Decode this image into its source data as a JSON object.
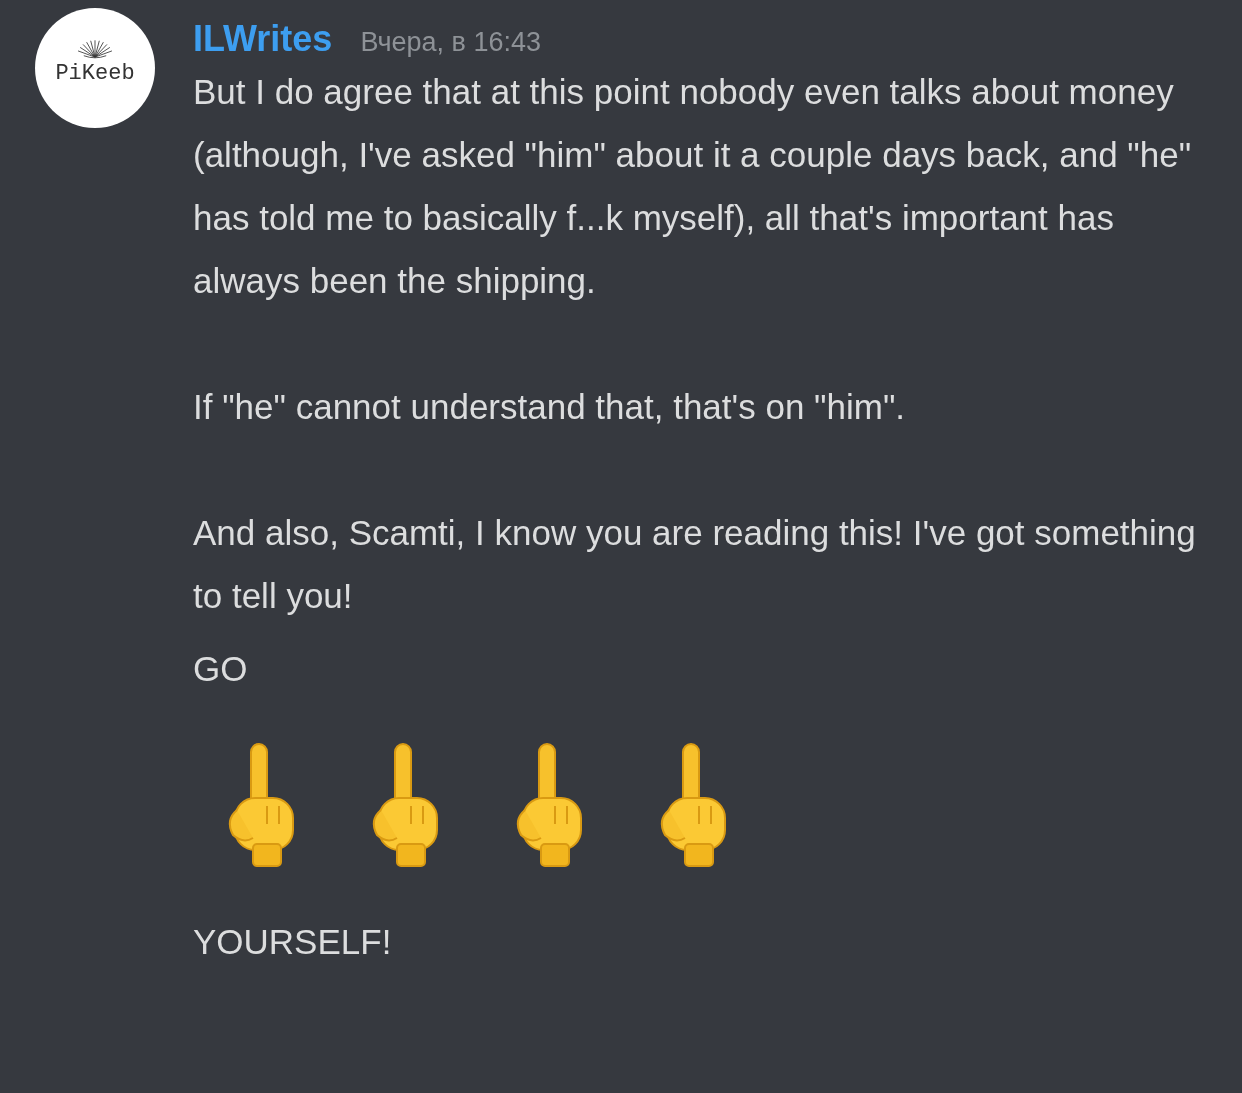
{
  "avatar": {
    "text": "PiKeeb"
  },
  "author": {
    "name": "ILWrites",
    "timestamp": "Вчера, в 16:43"
  },
  "messages": [
    {
      "kind": "text",
      "paragraphs": [
        "But I do agree that at this point nobody even talks about money (although, I've asked \"him\" about it a couple days back, and \"he\" has told me to basically f...k myself), all that's important has always been the shipping.",
        "If \"he\" cannot understand that, that's on \"him\".",
        "And also, Scamti, I know you are reading this! I've got something to tell you!"
      ]
    },
    {
      "kind": "text",
      "paragraphs": [
        "GO"
      ]
    },
    {
      "kind": "emojis",
      "items": [
        {
          "kind": "hand"
        },
        {
          "kind": "hand"
        },
        {
          "kind": "hand"
        },
        {
          "kind": "hand"
        }
      ]
    },
    {
      "kind": "text",
      "paragraphs": [
        "YOURSELF!"
      ]
    }
  ]
}
